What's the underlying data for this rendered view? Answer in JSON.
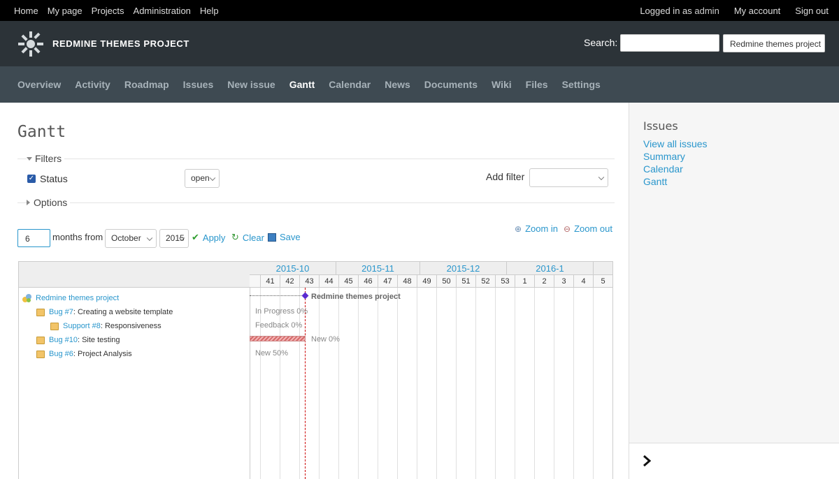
{
  "top_menu": {
    "items": [
      "Home",
      "My page",
      "Projects",
      "Administration",
      "Help"
    ],
    "logged_as_prefix": "Logged in as",
    "user": "admin",
    "account": "My account",
    "signout": "Sign out"
  },
  "header": {
    "title": "REDMINE THEMES PROJECT",
    "search_label": "Search:",
    "search_value": "",
    "project_jump": "Redmine themes project"
  },
  "main_menu": {
    "tabs": [
      "Overview",
      "Activity",
      "Roadmap",
      "Issues",
      "New issue",
      "Gantt",
      "Calendar",
      "News",
      "Documents",
      "Wiki",
      "Files",
      "Settings"
    ],
    "selected": "Gantt"
  },
  "page": {
    "title": "Gantt",
    "filters_legend": "Filters",
    "status_label": "Status",
    "status_checked": true,
    "status_operator": "open",
    "add_filter_label": "Add filter",
    "add_filter_value": "",
    "options_legend": "Options",
    "months_value": "6",
    "months_from_label": "months from",
    "month_select": "October",
    "year_select": "2015",
    "apply": "Apply",
    "clear": "Clear",
    "save": "Save",
    "zoom_in": "Zoom in",
    "zoom_out": "Zoom out"
  },
  "gantt": {
    "months": [
      "2015-10",
      "2015-11",
      "2015-12",
      "2016-1"
    ],
    "weeks": [
      "41",
      "42",
      "43",
      "44",
      "45",
      "46",
      "47",
      "48",
      "49",
      "50",
      "51",
      "52",
      "53",
      "1",
      "2",
      "3",
      "4",
      "5"
    ],
    "subjects": [
      {
        "link": "Redmine themes project",
        "text": "",
        "indent": 0,
        "type": "project"
      },
      {
        "link": "Bug #7",
        "text": ": Creating a website template",
        "indent": 1,
        "type": "issue"
      },
      {
        "link": "Support #8",
        "text": ": Responsiveness",
        "indent": 2,
        "type": "issue"
      },
      {
        "link": "Bug #10",
        "text": ": Site testing",
        "indent": 1,
        "type": "issue"
      },
      {
        "link": "Bug #6",
        "text": ": Project Analysis",
        "indent": 1,
        "type": "issue"
      }
    ],
    "bar_labels": {
      "project": "Redmine themes project",
      "bug7": "In Progress 0%",
      "support8": "Feedback 0%",
      "bug10": "New 0%",
      "bug6": "New 50%"
    }
  },
  "sidebar": {
    "title": "Issues",
    "links": [
      "View all issues",
      "Summary",
      "Calendar",
      "Gantt"
    ]
  },
  "colors": {
    "top_bar": "#000000",
    "header": "#2c3338",
    "main_menu": "#3e4a52",
    "link": "#2996cc",
    "today_line": "#cc0000",
    "milestone": "#5b2bd1"
  }
}
